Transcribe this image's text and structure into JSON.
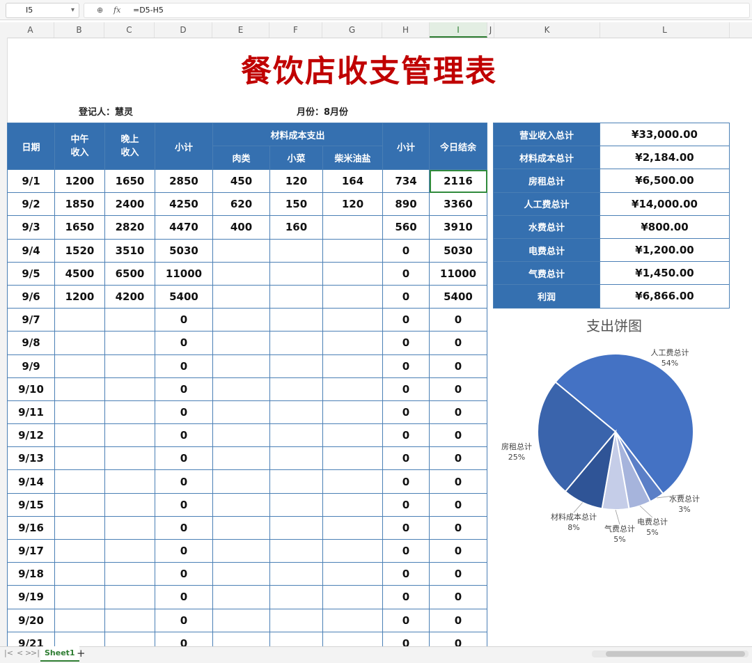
{
  "formula_bar": {
    "cell_ref": "I5",
    "zoom_icon": "zoom-icon",
    "fx_label": "fx",
    "formula": "=D5-H5"
  },
  "columns": [
    "A",
    "B",
    "C",
    "D",
    "E",
    "F",
    "G",
    "H",
    "I",
    "J",
    "K",
    "L"
  ],
  "selected_column": "I",
  "title": "餐饮店收支管理表",
  "recorder_label": "登记人：慧灵",
  "month_label": "月份：8月份",
  "headers": {
    "date": "日期",
    "noon": "中午收入",
    "evening": "晚上收入",
    "subtotal": "小计",
    "material_group": "材料成本支出",
    "meat": "肉类",
    "veg": "小菜",
    "grocery": "柴米油盐",
    "subtotal2": "小计",
    "balance": "今日结余"
  },
  "rows": [
    [
      "9/1",
      "1200",
      "1650",
      "2850",
      "450",
      "120",
      "164",
      "734",
      "2116"
    ],
    [
      "9/2",
      "1850",
      "2400",
      "4250",
      "620",
      "150",
      "120",
      "890",
      "3360"
    ],
    [
      "9/3",
      "1650",
      "2820",
      "4470",
      "400",
      "160",
      "",
      "560",
      "3910"
    ],
    [
      "9/4",
      "1520",
      "3510",
      "5030",
      "",
      "",
      "",
      "0",
      "5030"
    ],
    [
      "9/5",
      "4500",
      "6500",
      "11000",
      "",
      "",
      "",
      "0",
      "11000"
    ],
    [
      "9/6",
      "1200",
      "4200",
      "5400",
      "",
      "",
      "",
      "0",
      "5400"
    ],
    [
      "9/7",
      "",
      "",
      "0",
      "",
      "",
      "",
      "0",
      "0"
    ],
    [
      "9/8",
      "",
      "",
      "0",
      "",
      "",
      "",
      "0",
      "0"
    ],
    [
      "9/9",
      "",
      "",
      "0",
      "",
      "",
      "",
      "0",
      "0"
    ],
    [
      "9/10",
      "",
      "",
      "0",
      "",
      "",
      "",
      "0",
      "0"
    ],
    [
      "9/11",
      "",
      "",
      "0",
      "",
      "",
      "",
      "0",
      "0"
    ],
    [
      "9/12",
      "",
      "",
      "0",
      "",
      "",
      "",
      "0",
      "0"
    ],
    [
      "9/13",
      "",
      "",
      "0",
      "",
      "",
      "",
      "0",
      "0"
    ],
    [
      "9/14",
      "",
      "",
      "0",
      "",
      "",
      "",
      "0",
      "0"
    ],
    [
      "9/15",
      "",
      "",
      "0",
      "",
      "",
      "",
      "0",
      "0"
    ],
    [
      "9/16",
      "",
      "",
      "0",
      "",
      "",
      "",
      "0",
      "0"
    ],
    [
      "9/17",
      "",
      "",
      "0",
      "",
      "",
      "",
      "0",
      "0"
    ],
    [
      "9/18",
      "",
      "",
      "0",
      "",
      "",
      "",
      "0",
      "0"
    ],
    [
      "9/19",
      "",
      "",
      "0",
      "",
      "",
      "",
      "0",
      "0"
    ],
    [
      "9/20",
      "",
      "",
      "0",
      "",
      "",
      "",
      "0",
      "0"
    ],
    [
      "9/21",
      "",
      "",
      "0",
      "",
      "",
      "",
      "0",
      "0"
    ]
  ],
  "summary": [
    {
      "k": "营业收入总计",
      "v": "¥33,000.00"
    },
    {
      "k": "材料成本总计",
      "v": "¥2,184.00"
    },
    {
      "k": "房租总计",
      "v": "¥6,500.00"
    },
    {
      "k": "人工费总计",
      "v": "¥14,000.00"
    },
    {
      "k": "水费总计",
      "v": "¥800.00"
    },
    {
      "k": "电费总计",
      "v": "¥1,200.00"
    },
    {
      "k": "气费总计",
      "v": "¥1,450.00"
    },
    {
      "k": "利润",
      "v": "¥6,866.00"
    }
  ],
  "chart_data": {
    "type": "pie",
    "title": "支出饼图",
    "slices": [
      {
        "name": "人工费总计",
        "pct": "54%",
        "value": 14000,
        "color": "#4472c4"
      },
      {
        "name": "水费总计",
        "pct": "3%",
        "value": 800,
        "color": "#5b7fc7"
      },
      {
        "name": "电费总计",
        "pct": "5%",
        "value": 1200,
        "color": "#a6b4dc"
      },
      {
        "name": "气费总计",
        "pct": "5%",
        "value": 1450,
        "color": "#c5cde8"
      },
      {
        "name": "材料成本总计",
        "pct": "8%",
        "value": 2184,
        "color": "#2f5496"
      },
      {
        "name": "房租总计",
        "pct": "25%",
        "value": 6500,
        "color": "#3a64ac"
      }
    ]
  },
  "sheet_tab": "Sheet1",
  "add_sheet": "+",
  "nav": [
    "|<",
    "<",
    ">",
    ">|"
  ]
}
